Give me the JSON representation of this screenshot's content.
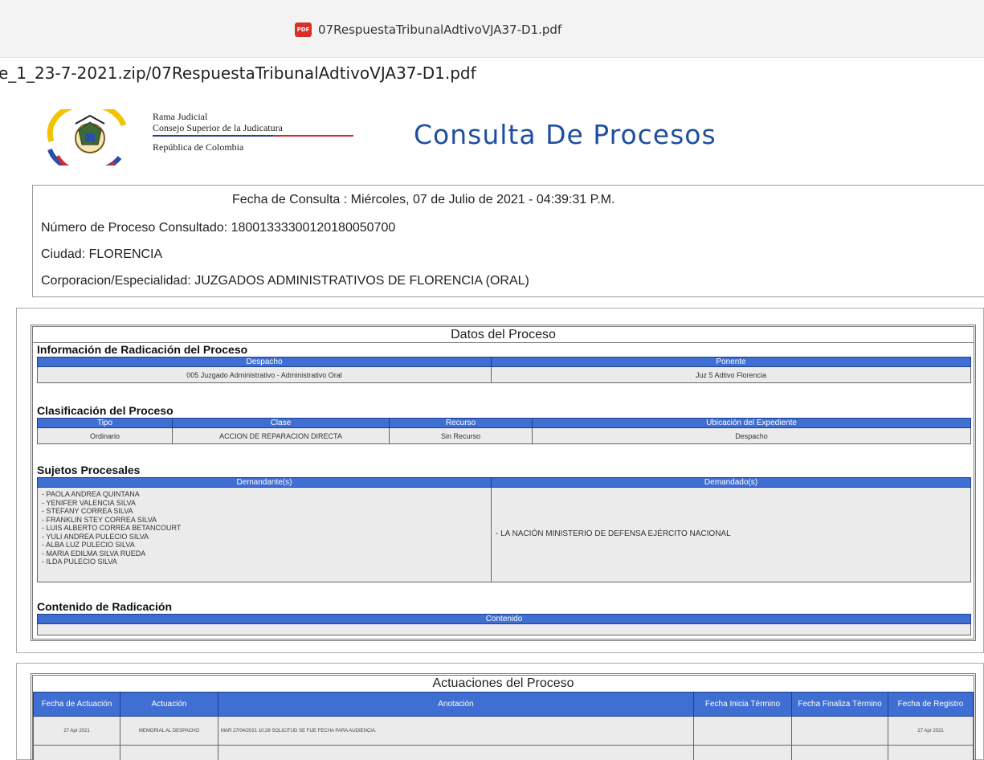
{
  "viewer": {
    "tab_title": "07RespuestaTribunalAdtivoVJA37-D1.pdf",
    "path": "e_1_23-7-2021.zip/07RespuestaTribunalAdtivoVJA37-D1.pdf",
    "pdf_icon_label": "PDF"
  },
  "header": {
    "institution_line1": "Rama Judicial",
    "institution_line2": "Consejo Superior de la Judicatura",
    "institution_line3": "República de Colombia",
    "title": "Consulta De Procesos"
  },
  "consulta": {
    "fecha": "Fecha de Consulta : Miércoles, 07 de Julio de 2021 - 04:39:31 P.M.",
    "numero": "Número de Proceso Consultado: 18001333300120180050700",
    "ciudad": "Ciudad: FLORENCIA",
    "corporacion": "Corporacion/Especialidad: JUZGADOS ADMINISTRATIVOS DE FLORENCIA (ORAL)"
  },
  "datos": {
    "title": "Datos del Proceso",
    "radicacion": {
      "heading": "Información de Radicación del Proceso",
      "col_despacho": "Despacho",
      "col_ponente": "Ponente",
      "despacho": "005 Juzgado Administrativo - Administrativo Oral",
      "ponente": "Juz 5 Adtivo Florencia"
    },
    "clasificacion": {
      "heading": "Clasificación del Proceso",
      "col_tipo": "Tipo",
      "col_clase": "Clase",
      "col_recurso": "Recurso",
      "col_ubicacion": "Ubicación del Expediente",
      "tipo": "Ordinario",
      "clase": "ACCION DE REPARACION DIRECTA",
      "recurso": "Sin Recurso",
      "ubicacion": "Despacho"
    },
    "sujetos": {
      "heading": "Sujetos Procesales",
      "col_demandantes": "Demandante(s)",
      "col_demandados": "Demandado(s)",
      "demandantes": [
        "- PAOLA ANDREA QUINTANA",
        "- YENIFER VALENCIA SILVA",
        "- STEFANY CORREA SILVA",
        "- FRANKLIN STEY CORREA SILVA",
        "- LUIS ALBERTO CORREA BETANCOURT",
        "- YULI ANDREA PULECIO SILVA",
        "- ALBA LUZ PULECIO SILVA",
        "- MARIA EDILMA SILVA RUEDA",
        "- ILDA PULECIO SILVA"
      ],
      "demandado": "- LA NACIÓN MINISTERIO DE DEFENSA EJÉRCITO NACIONAL"
    },
    "contenido": {
      "heading": "Contenido de Radicación",
      "col_contenido": "Contenido",
      "value": ""
    }
  },
  "actuaciones": {
    "title": "Actuaciones del Proceso",
    "col_fecha": "Fecha de Actuación",
    "col_actuacion": "Actuación",
    "col_anotacion": "Anotación",
    "col_inicia": "Fecha Inicia Término",
    "col_finaliza": "Fecha Finaliza Término",
    "col_registro": "Fecha de Registro",
    "rows": [
      {
        "fecha": "27 Apr 2021",
        "actuacion": "MEMORIAL AL DESPACHO",
        "anotacion": "MAR 27/04/2021 10:28 SOLICITUD SE FIJE FECHA PARA AUDIENCIA.",
        "inicia": "",
        "finaliza": "",
        "registro": "27 Apr 2021"
      }
    ]
  }
}
